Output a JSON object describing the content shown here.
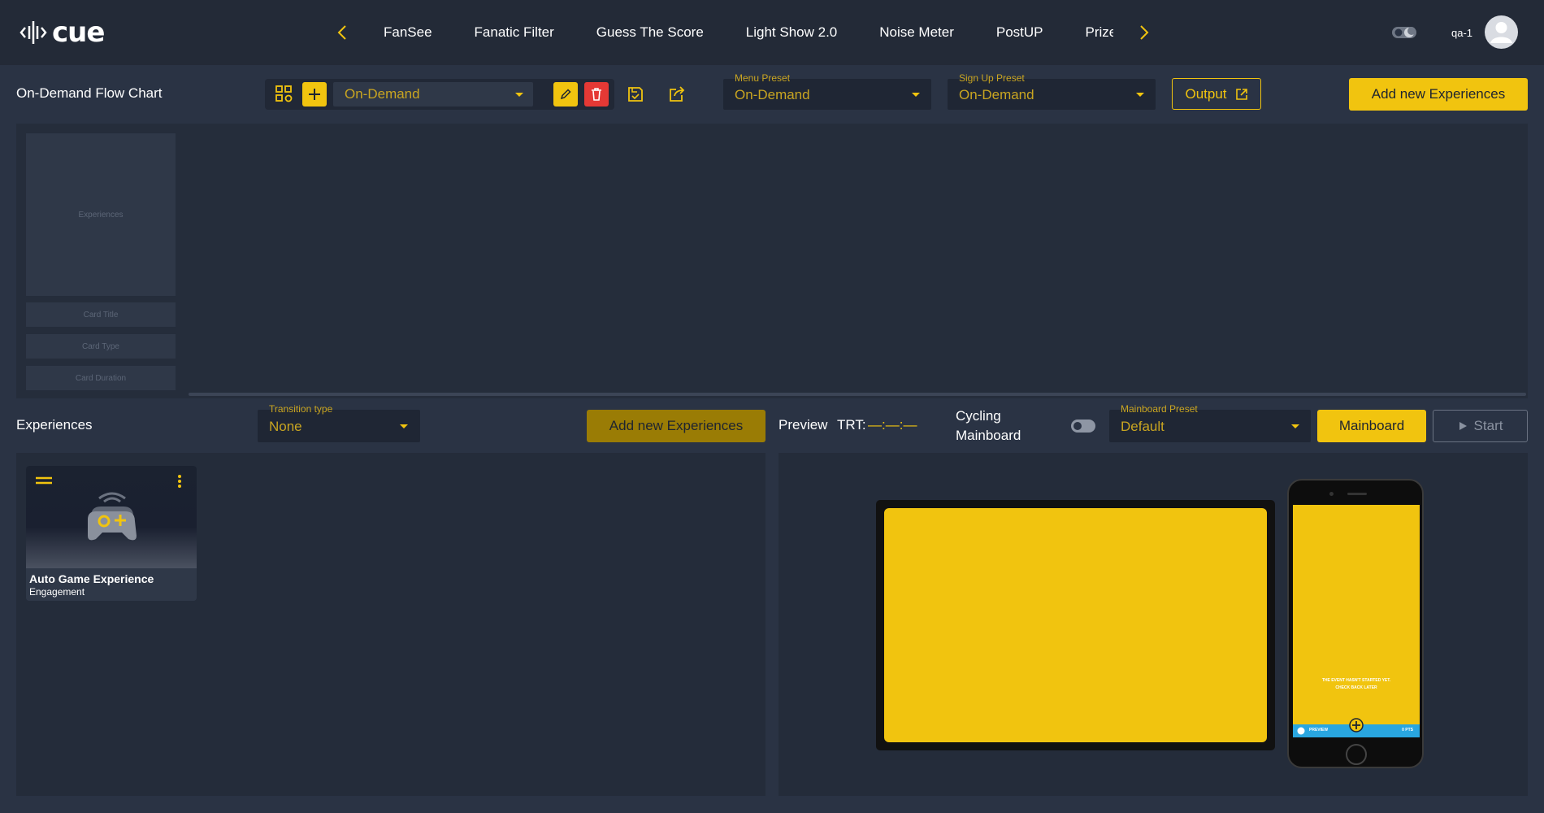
{
  "app": {
    "logo_text": "cue"
  },
  "nav": {
    "items": [
      "FanSee",
      "Fanatic Filter",
      "Guess The Score",
      "Light Show 2.0",
      "Noise Meter",
      "PostUP",
      "Prize D"
    ]
  },
  "user": {
    "name": "qa-1"
  },
  "toolbar": {
    "page_title": "On-Demand Flow Chart",
    "flow_select": "On-Demand",
    "menu_preset": {
      "label": "Menu Preset",
      "value": "On-Demand"
    },
    "signup_preset": {
      "label": "Sign Up Preset",
      "value": "On-Demand"
    },
    "output_label": "Output",
    "add_new_label": "Add new Experiences"
  },
  "flow_chart": {
    "ghost_card_label": "Experiences",
    "ghost_fields": [
      "Card Title",
      "Card Type",
      "Card Duration"
    ]
  },
  "experiences": {
    "title": "Experiences",
    "transition": {
      "label": "Transition type",
      "value": "None"
    },
    "add_new_label": "Add new Experiences",
    "cards": [
      {
        "name": "Auto Game Experience",
        "type": "Engagement"
      }
    ]
  },
  "preview": {
    "title": "Preview",
    "trt_label": "TRT:",
    "trt_value": "—:—:—",
    "cycling_label_1": "Cycling",
    "cycling_label_2": "Mainboard",
    "mainboard_preset": {
      "label": "Mainboard Preset",
      "value": "Default"
    },
    "mainboard_button": "Mainboard",
    "start_button": "Start",
    "phone_message_1": "THE EVENT HASN'T STARTED YET.",
    "phone_message_2": "CHECK BACK LATER",
    "phone_bar_left": "PREVIEW",
    "phone_bar_right": "0 PTS"
  },
  "colors": {
    "accent": "#f1c40f",
    "danger": "#e53935",
    "background": "#2a3344",
    "topbar": "#232a37"
  }
}
